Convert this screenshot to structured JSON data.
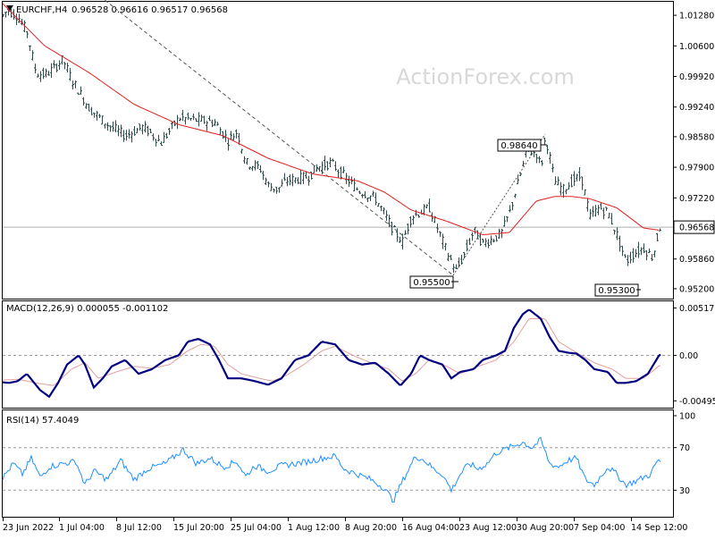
{
  "chart_data": [
    {
      "type": "candlestick",
      "header": {
        "symbol_timeframe": "EURCHF,H4",
        "ohlc": "0.96528 0.96616 0.96517 0.96568"
      },
      "watermark": "ActionForex.com",
      "series": [
        {
          "kind": "price-bars"
        },
        {
          "kind": "moving-average"
        },
        {
          "kind": "trend-line-dashed"
        }
      ],
      "y_ticks": [
        "1.01280",
        "1.00600",
        "0.99920",
        "0.99240",
        "0.98580",
        "0.97900",
        "0.97220",
        "0.96568",
        "0.95860",
        "0.95200"
      ],
      "current_price": "0.96568",
      "ylim": [
        0.9498,
        1.0158
      ],
      "annotations": [
        "0.98640",
        "0.95500",
        "0.95300"
      ],
      "price_waypoints": [
        [
          0,
          1.012
        ],
        [
          8,
          1.014
        ],
        [
          20,
          1.0125
        ],
        [
          30,
          1.009
        ],
        [
          40,
          1.0
        ],
        [
          50,
          0.9995
        ],
        [
          60,
          1.001
        ],
        [
          70,
          1.003
        ],
        [
          80,
          0.9985
        ],
        [
          100,
          0.992
        ],
        [
          120,
          0.9885
        ],
        [
          140,
          0.986
        ],
        [
          160,
          0.988
        ],
        [
          180,
          0.9845
        ],
        [
          200,
          0.99
        ],
        [
          220,
          0.9895
        ],
        [
          240,
          0.989
        ],
        [
          255,
          0.985
        ],
        [
          265,
          0.987
        ],
        [
          275,
          0.98
        ],
        [
          290,
          0.979
        ],
        [
          300,
          0.975
        ],
        [
          310,
          0.974
        ],
        [
          320,
          0.976
        ],
        [
          335,
          0.9765
        ],
        [
          345,
          0.977
        ],
        [
          355,
          0.979
        ],
        [
          370,
          0.98
        ],
        [
          385,
          0.977
        ],
        [
          400,
          0.974
        ],
        [
          420,
          0.972
        ],
        [
          440,
          0.965
        ],
        [
          450,
          0.9625
        ],
        [
          460,
          0.968
        ],
        [
          470,
          0.969
        ],
        [
          480,
          0.97
        ],
        [
          490,
          0.965
        ],
        [
          500,
          0.96
        ],
        [
          510,
          0.956
        ],
        [
          520,
          0.96
        ],
        [
          530,
          0.965
        ],
        [
          540,
          0.962
        ],
        [
          550,
          0.963
        ],
        [
          560,
          0.964
        ],
        [
          570,
          0.969
        ],
        [
          580,
          0.976
        ],
        [
          590,
          0.983
        ],
        [
          600,
          0.982
        ],
        [
          605,
          0.979
        ],
        [
          610,
          0.986
        ],
        [
          620,
          0.976
        ],
        [
          630,
          0.974
        ],
        [
          640,
          0.976
        ],
        [
          650,
          0.977
        ],
        [
          660,
          0.968
        ],
        [
          670,
          0.97
        ],
        [
          680,
          0.969
        ],
        [
          690,
          0.964
        ],
        [
          700,
          0.958
        ],
        [
          710,
          0.96
        ],
        [
          720,
          0.961
        ],
        [
          730,
          0.959
        ],
        [
          738,
          0.9657
        ]
      ],
      "ma_waypoints": [
        [
          0,
          1.016
        ],
        [
          50,
          1.006
        ],
        [
          100,
          1.0
        ],
        [
          150,
          0.993
        ],
        [
          200,
          0.9885
        ],
        [
          250,
          0.986
        ],
        [
          300,
          0.981
        ],
        [
          350,
          0.9775
        ],
        [
          400,
          0.976
        ],
        [
          430,
          0.9735
        ],
        [
          460,
          0.9695
        ],
        [
          500,
          0.967
        ],
        [
          540,
          0.964
        ],
        [
          570,
          0.9645
        ],
        [
          600,
          0.9715
        ],
        [
          620,
          0.9725
        ],
        [
          640,
          0.9725
        ],
        [
          660,
          0.972
        ],
        [
          690,
          0.97
        ],
        [
          720,
          0.9655
        ],
        [
          738,
          0.965
        ]
      ],
      "trendline": {
        "from": [
          112,
          1.017
        ],
        "to": [
          507,
          0.955
        ]
      }
    },
    {
      "type": "line",
      "title": "MACD(12,26,9) 0.000055 -0.001102",
      "y_ticks": [
        "0.005171",
        "0.00",
        "-0.004954"
      ],
      "ylim": [
        -0.0057,
        0.0059
      ],
      "series": [
        {
          "kind": "macd-line",
          "waypoints": [
            [
              0,
              -0.0029
            ],
            [
              10,
              -0.003
            ],
            [
              20,
              -0.0028
            ],
            [
              30,
              -0.002
            ],
            [
              45,
              -0.0038
            ],
            [
              55,
              -0.0045
            ],
            [
              65,
              -0.003
            ],
            [
              75,
              -0.001
            ],
            [
              88,
              0.0
            ],
            [
              95,
              -0.001
            ],
            [
              105,
              -0.0035
            ],
            [
              115,
              -0.0025
            ],
            [
              125,
              -0.0012
            ],
            [
              140,
              -0.0005
            ],
            [
              155,
              -0.002
            ],
            [
              170,
              -0.0015
            ],
            [
              185,
              -0.0005
            ],
            [
              200,
              0.0
            ],
            [
              210,
              0.0015
            ],
            [
              222,
              0.0018
            ],
            [
              235,
              0.0012
            ],
            [
              245,
              -0.0005
            ],
            [
              255,
              -0.0025
            ],
            [
              270,
              -0.0025
            ],
            [
              285,
              -0.0028
            ],
            [
              300,
              -0.0032
            ],
            [
              315,
              -0.0025
            ],
            [
              330,
              -0.0005
            ],
            [
              345,
              0.0
            ],
            [
              360,
              0.0015
            ],
            [
              375,
              0.0012
            ],
            [
              390,
              -0.0005
            ],
            [
              405,
              -0.001
            ],
            [
              420,
              -0.0008
            ],
            [
              435,
              -0.002
            ],
            [
              448,
              -0.0033
            ],
            [
              460,
              -0.002
            ],
            [
              470,
              0.0
            ],
            [
              480,
              -0.0005
            ],
            [
              495,
              -0.001
            ],
            [
              505,
              -0.0025
            ],
            [
              515,
              -0.0018
            ],
            [
              530,
              -0.0015
            ],
            [
              540,
              -0.0005
            ],
            [
              555,
              0.0
            ],
            [
              565,
              0.0005
            ],
            [
              575,
              0.003
            ],
            [
              585,
              0.0045
            ],
            [
              592,
              0.005
            ],
            [
              605,
              0.004
            ],
            [
              615,
              0.002
            ],
            [
              625,
              0.0005
            ],
            [
              635,
              0.0003
            ],
            [
              645,
              0.0002
            ],
            [
              655,
              -0.0005
            ],
            [
              665,
              -0.0015
            ],
            [
              680,
              -0.0018
            ],
            [
              690,
              -0.003
            ],
            [
              700,
              -0.003
            ],
            [
              712,
              -0.0028
            ],
            [
              725,
              -0.002
            ],
            [
              738,
              0.0001
            ]
          ]
        },
        {
          "kind": "signal-line",
          "waypoints": [
            [
              0,
              -0.0027
            ],
            [
              20,
              -0.0026
            ],
            [
              40,
              -0.003
            ],
            [
              60,
              -0.0033
            ],
            [
              80,
              -0.0015
            ],
            [
              95,
              -0.0008
            ],
            [
              110,
              -0.0025
            ],
            [
              130,
              -0.0018
            ],
            [
              150,
              -0.0012
            ],
            [
              170,
              -0.0014
            ],
            [
              190,
              -0.001
            ],
            [
              210,
              0.0005
            ],
            [
              225,
              0.0012
            ],
            [
              240,
              0.001
            ],
            [
              255,
              -0.001
            ],
            [
              270,
              -0.002
            ],
            [
              290,
              -0.0025
            ],
            [
              305,
              -0.0028
            ],
            [
              320,
              -0.0022
            ],
            [
              340,
              -0.001
            ],
            [
              360,
              0.0005
            ],
            [
              375,
              0.001
            ],
            [
              395,
              0.0
            ],
            [
              415,
              -0.0008
            ],
            [
              435,
              -0.0015
            ],
            [
              450,
              -0.0028
            ],
            [
              465,
              -0.002
            ],
            [
              480,
              -0.0005
            ],
            [
              500,
              -0.0012
            ],
            [
              515,
              -0.002
            ],
            [
              535,
              -0.0012
            ],
            [
              555,
              -0.0005
            ],
            [
              575,
              0.0015
            ],
            [
              592,
              0.004
            ],
            [
              610,
              0.004
            ],
            [
              625,
              0.0015
            ],
            [
              645,
              0.0003
            ],
            [
              665,
              -0.0008
            ],
            [
              685,
              -0.0015
            ],
            [
              700,
              -0.0025
            ],
            [
              720,
              -0.0025
            ],
            [
              738,
              -0.0011
            ]
          ]
        }
      ]
    },
    {
      "type": "line",
      "title": "RSI(14) 57.4049",
      "y_ticks": [
        "100",
        "70",
        "30"
      ],
      "ylim": [
        0,
        100
      ],
      "levels": [
        70,
        30
      ],
      "series": [
        {
          "kind": "rsi-line",
          "waypoints": [
            [
              0,
              38
            ],
            [
              15,
              55
            ],
            [
              25,
              45
            ],
            [
              35,
              60
            ],
            [
              45,
              42
            ],
            [
              55,
              52
            ],
            [
              70,
              55
            ],
            [
              85,
              57
            ],
            [
              95,
              35
            ],
            [
              105,
              48
            ],
            [
              120,
              40
            ],
            [
              135,
              58
            ],
            [
              150,
              40
            ],
            [
              165,
              50
            ],
            [
              185,
              55
            ],
            [
              205,
              68
            ],
            [
              220,
              55
            ],
            [
              235,
              60
            ],
            [
              250,
              52
            ],
            [
              265,
              57
            ],
            [
              275,
              43
            ],
            [
              285,
              53
            ],
            [
              300,
              48
            ],
            [
              315,
              53
            ],
            [
              330,
              55
            ],
            [
              345,
              57
            ],
            [
              360,
              60
            ],
            [
              375,
              62
            ],
            [
              385,
              50
            ],
            [
              400,
              45
            ],
            [
              415,
              40
            ],
            [
              430,
              32
            ],
            [
              440,
              20
            ],
            [
              450,
              38
            ],
            [
              465,
              62
            ],
            [
              475,
              58
            ],
            [
              485,
              50
            ],
            [
              495,
              45
            ],
            [
              505,
              30
            ],
            [
              515,
              45
            ],
            [
              525,
              55
            ],
            [
              535,
              50
            ],
            [
              545,
              55
            ],
            [
              555,
              65
            ],
            [
              570,
              70
            ],
            [
              585,
              75
            ],
            [
              595,
              70
            ],
            [
              605,
              77
            ],
            [
              615,
              55
            ],
            [
              625,
              52
            ],
            [
              635,
              58
            ],
            [
              645,
              60
            ],
            [
              655,
              40
            ],
            [
              665,
              35
            ],
            [
              680,
              52
            ],
            [
              690,
              45
            ],
            [
              700,
              35
            ],
            [
              710,
              38
            ],
            [
              720,
              42
            ],
            [
              728,
              45
            ],
            [
              735,
              57
            ],
            [
              738,
              57
            ]
          ]
        }
      ]
    }
  ],
  "x_axis": {
    "labels": [
      "23 Jun 2022",
      "1 Jul 04:00",
      "8 Jul 12:00",
      "15 Jul 20:00",
      "25 Jul 04:00",
      "1 Aug 12:00",
      "8 Aug 20:00",
      "16 Aug 04:00",
      "23 Aug 12:00",
      "30 Aug 20:00",
      "7 Sep 04:00",
      "14 Sep 12:00"
    ]
  },
  "colors": {
    "bars": "#2f4f4f",
    "ma": "#e02020",
    "macd": "#000080",
    "signal": "#e0a0a0",
    "rsi": "#1e90ff",
    "trendline": "#555555",
    "watermark": "#d8d8d8"
  }
}
